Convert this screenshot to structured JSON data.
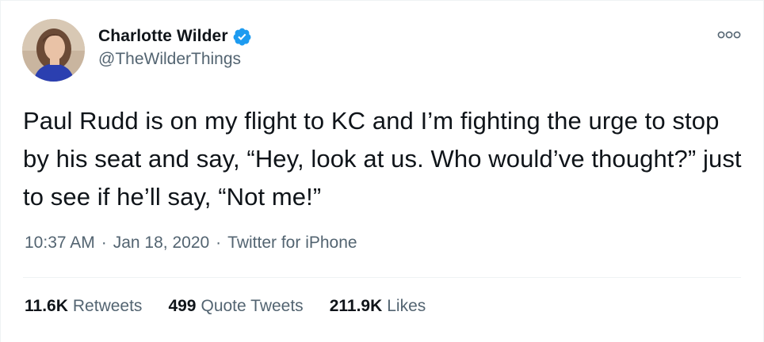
{
  "author": {
    "display_name": "Charlotte Wilder",
    "handle": "@TheWilderThings",
    "verified": true,
    "avatar_icon": "profile-photo"
  },
  "tweet": {
    "text": "Paul Rudd is on my flight to KC and I’m fighting the urge to stop by his seat and say, “Hey, look at us. Who would’ve thought?” just to see if he’ll say, “Not me!”",
    "time": "10:37 AM",
    "date": "Jan 18, 2020",
    "separator": "·",
    "source": "Twitter for iPhone"
  },
  "stats": {
    "retweets_count": "11.6K",
    "retweets_label": "Retweets",
    "quote_tweets_count": "499",
    "quote_tweets_label": "Quote Tweets",
    "likes_count": "211.9K",
    "likes_label": "Likes"
  },
  "colors": {
    "text_primary": "#0f1419",
    "text_secondary": "#536471",
    "verified_blue": "#1d9bf0",
    "divider": "#eff3f4"
  },
  "icons": {
    "verified": "verified-badge-icon",
    "more": "more-options-icon"
  }
}
